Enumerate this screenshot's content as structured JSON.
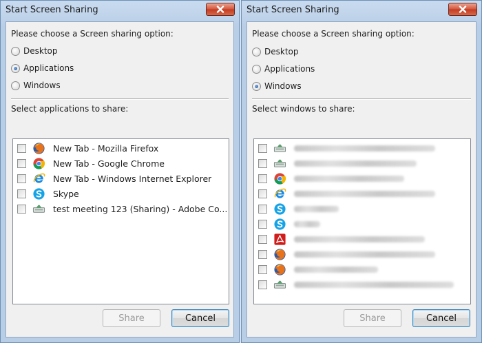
{
  "left_dialog": {
    "title": "Start Screen Sharing",
    "prompt": "Please choose a Screen sharing option:",
    "options": [
      {
        "label": "Desktop",
        "checked": false
      },
      {
        "label": "Applications",
        "checked": true
      },
      {
        "label": "Windows",
        "checked": false
      }
    ],
    "select_label": "Select applications to share:",
    "items": [
      {
        "icon": "firefox-icon",
        "label": "New Tab - Mozilla Firefox",
        "checked": false
      },
      {
        "icon": "chrome-icon",
        "label": "New Tab - Google Chrome",
        "checked": false
      },
      {
        "icon": "internet-explorer-icon",
        "label": "New Tab - Windows Internet Explorer",
        "checked": false
      },
      {
        "icon": "skype-icon",
        "label": "Skype",
        "checked": false
      },
      {
        "icon": "adobe-connect-icon",
        "label": "test meeting 123 (Sharing) - Adobe Co...",
        "checked": false
      }
    ],
    "share_label": "Share",
    "cancel_label": "Cancel"
  },
  "right_dialog": {
    "title": "Start Screen Sharing",
    "prompt": "Please choose a Screen sharing option:",
    "options": [
      {
        "label": "Desktop",
        "checked": false
      },
      {
        "label": "Applications",
        "checked": false
      },
      {
        "label": "Windows",
        "checked": true
      }
    ],
    "select_label": "Select windows to share:",
    "items": [
      {
        "icon": "adobe-connect-icon",
        "checked": false
      },
      {
        "icon": "adobe-connect-icon",
        "checked": false
      },
      {
        "icon": "chrome-icon",
        "checked": false
      },
      {
        "icon": "internet-explorer-icon",
        "checked": false
      },
      {
        "icon": "skype-icon",
        "checked": false
      },
      {
        "icon": "skype-icon",
        "checked": false
      },
      {
        "icon": "acrobat-icon",
        "checked": false
      },
      {
        "icon": "firefox-icon",
        "checked": false
      },
      {
        "icon": "firefox-icon",
        "checked": false
      },
      {
        "icon": "adobe-connect-icon",
        "checked": false
      }
    ],
    "share_label": "Share",
    "cancel_label": "Cancel"
  }
}
